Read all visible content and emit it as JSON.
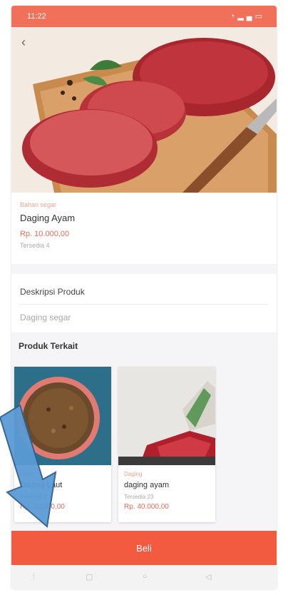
{
  "status_bar": {
    "time": "11:22",
    "icons": [
      "wifi-icon",
      "signal-icon",
      "battery-icon"
    ]
  },
  "product": {
    "category": "Bahan segar",
    "name": "Daging Ayam",
    "price": "Rp. 10.000,00",
    "stock": "Tersedia 4"
  },
  "description": {
    "title": "Deskripsi Produk",
    "body": "Daging segar"
  },
  "related": {
    "title": "Produk Terkait",
    "items": [
      {
        "category": "Bahan",
        "name": "Daging Laut",
        "stock": "Tersedia 7",
        "price": "Rp. 10.000,00"
      },
      {
        "category": "Daging",
        "name": "daging ayam",
        "stock": "Tersedia 23",
        "price": "Rp. 40.000,00"
      }
    ]
  },
  "buy_button": {
    "label": "Beli"
  },
  "colors": {
    "accent": "#f25b3f",
    "status_bar": "#f0705a",
    "price": "#ea6b5b",
    "annotation_arrow": "#5b9bd5"
  }
}
